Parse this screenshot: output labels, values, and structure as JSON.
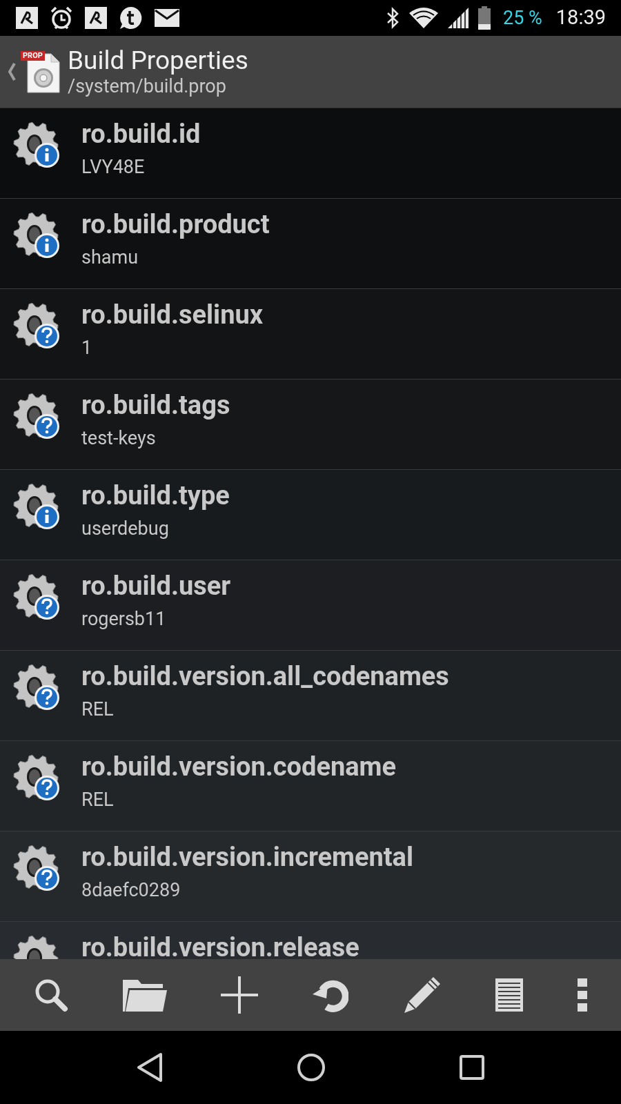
{
  "status_bar": {
    "battery": "25 %",
    "time": "18:39"
  },
  "header": {
    "icon_label": "PROP",
    "title": "Build Properties",
    "subtitle": "/system/build.prop"
  },
  "properties": [
    {
      "key": "ro.build.id",
      "value": "LVY48E",
      "kind": "info"
    },
    {
      "key": "ro.build.product",
      "value": "shamu",
      "kind": "info"
    },
    {
      "key": "ro.build.selinux",
      "value": "1",
      "kind": "question"
    },
    {
      "key": "ro.build.tags",
      "value": "test-keys",
      "kind": "question"
    },
    {
      "key": "ro.build.type",
      "value": "userdebug",
      "kind": "info"
    },
    {
      "key": "ro.build.user",
      "value": "rogersb11",
      "kind": "question"
    },
    {
      "key": "ro.build.version.all_codenames",
      "value": "REL",
      "kind": "question"
    },
    {
      "key": "ro.build.version.codename",
      "value": "REL",
      "kind": "question"
    },
    {
      "key": "ro.build.version.incremental",
      "value": "8daefc0289",
      "kind": "question"
    },
    {
      "key": "ro.build.version.release"
    }
  ]
}
